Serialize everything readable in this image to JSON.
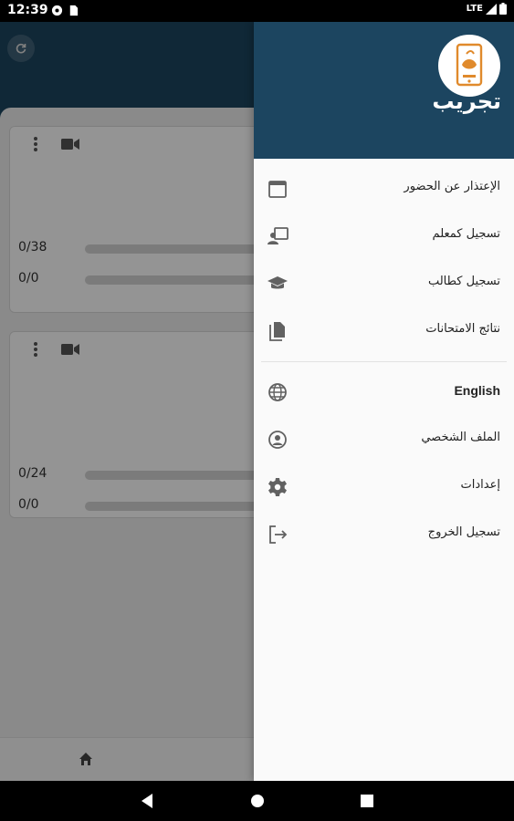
{
  "status_bar": {
    "time": "12:39",
    "network": "LTE",
    "left_icons": [
      "settings-icon",
      "sim-card-icon"
    ],
    "right_icons": [
      "signal-icon",
      "battery-icon"
    ]
  },
  "app": {
    "cards": [
      {
        "row1": "0/38",
        "row2": "0/0"
      },
      {
        "row1": "0/24",
        "row2": "0/0"
      }
    ]
  },
  "drawer": {
    "title": "تجريب",
    "logo_icon": "app-logo-icon",
    "items": [
      {
        "label": "الإعتذار عن الحضور",
        "icon": "calendar-icon"
      },
      {
        "label": "تسجيل كمعلم",
        "icon": "teacher-icon"
      },
      {
        "label": "تسجيل كطالب",
        "icon": "graduation-cap-icon"
      },
      {
        "label": "نتائج الامتحانات",
        "icon": "documents-icon"
      }
    ],
    "items2": [
      {
        "label": "English",
        "icon": "globe-icon"
      },
      {
        "label": "الملف الشخصي",
        "icon": "profile-icon"
      },
      {
        "label": "إعدادات",
        "icon": "gear-icon"
      },
      {
        "label": "تسجيل الخروج",
        "icon": "logout-icon"
      }
    ]
  },
  "colors": {
    "header": "#1c4560",
    "drawer_bg": "#fafafa",
    "logo_accent": "#e08a2c"
  }
}
